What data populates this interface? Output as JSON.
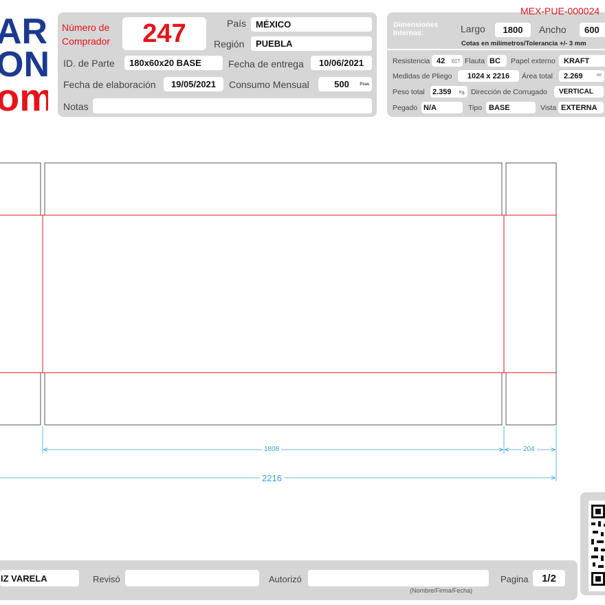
{
  "logo": {
    "line1": "AR",
    "line2": "ON",
    "line3": "om"
  },
  "header": {
    "buyer_number_label": "Número de Comprador",
    "buyer_number": "247",
    "country_label": "País",
    "country": "MÉXICO",
    "region_label": "Región",
    "region": "PUEBLA",
    "part_id_label": "ID. de Parte",
    "part_id": "180x60x20 BASE",
    "delivery_date_label": "Fecha de entrega",
    "delivery_date": "10/06/2021",
    "elaboration_date_label": "Fecha de elaboración",
    "elaboration_date": "19/05/2021",
    "monthly_consumption_label": "Consumo Mensual",
    "monthly_consumption": "500",
    "monthly_consumption_unit": "Pzas",
    "notes_label": "Notas",
    "notes": ""
  },
  "spec": {
    "code": "MEX-PUE-000024",
    "internal_dims_label": "Dimensiones Internas:",
    "length_label": "Largo",
    "length": "1800",
    "width_label": "Ancho",
    "width": "600",
    "tolerance_note": "Cotas en milímetros/Tolerancia +/- 3 mm",
    "resistance_label": "Resistencia",
    "resistance": "42",
    "resistance_unit": "ECT",
    "flute_label": "Flauta",
    "flute": "BC",
    "outer_paper_label": "Papel externo",
    "outer_paper": "KRAFT",
    "sheet_size_label": "Medidas de Pliego",
    "sheet_size": "1024 x 2216",
    "total_area_label": "Área total",
    "total_area": "2.269",
    "total_area_unit": "m²",
    "total_weight_label": "Peso total",
    "total_weight": "2.359",
    "total_weight_unit": "Kg.",
    "corrugation_direction_label": "Dirección de Corrugado",
    "corrugation_direction": "VERTICAL",
    "glued_label": "Pegado",
    "glued": "N/A",
    "type_label": "Tipo",
    "type": "BASE",
    "view_label": "Vista",
    "view": "EXTERNA"
  },
  "drawing": {
    "dim_main": "1808",
    "dim_side": "204",
    "dim_total": "2216"
  },
  "footer": {
    "elaborated_by": "IZ VARELA",
    "reviewed_label": "Revisó",
    "reviewed": "",
    "authorized_label": "Autorizó",
    "authorized": "",
    "signature_hint": "(Nombre/Firma/Fecha)",
    "page_label": "Pagina",
    "page": "1/2"
  },
  "colors": {
    "panel": "#d6d6d6",
    "accent_red": "#e4141b",
    "logo_blue": "#1b3a8f",
    "dimension_blue": "#3aa0d8",
    "fold_red": "#e4141b",
    "cut_line": "#555555"
  }
}
